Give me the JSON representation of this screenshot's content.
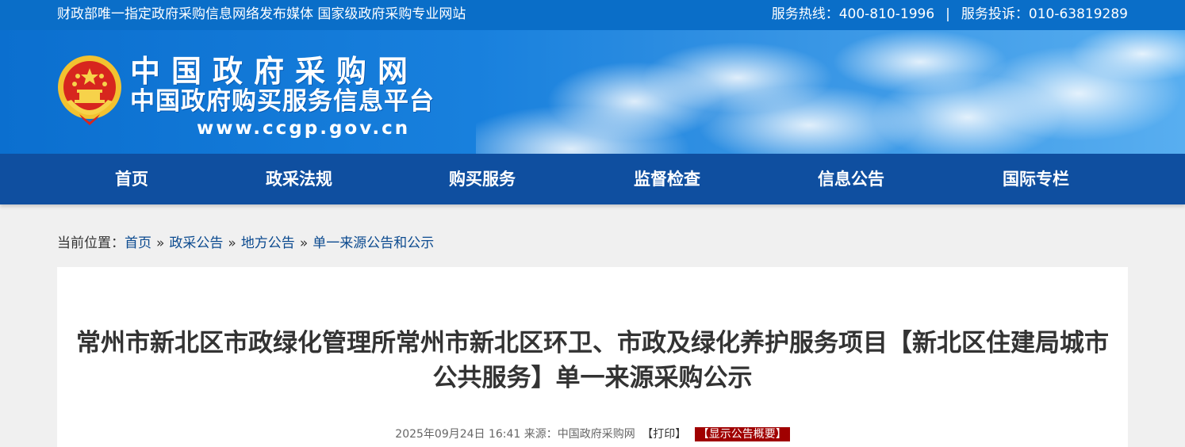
{
  "topbar": {
    "slogan": "财政部唯一指定政府采购信息网络发布媒体 国家级政府采购专业网站",
    "hotline": "服务热线：400-810-1996",
    "separator": "|",
    "complaint": "服务投诉：010-63819289"
  },
  "header": {
    "logo_title": "中国政府采购网",
    "logo_subtitle": "中国政府购买服务信息平台",
    "logo_url": "www.ccgp.gov.cn",
    "emblem_icon": "national-emblem-icon"
  },
  "nav": {
    "items": [
      {
        "label": "首页"
      },
      {
        "label": "政采法规"
      },
      {
        "label": "购买服务"
      },
      {
        "label": "监督检查"
      },
      {
        "label": "信息公告"
      },
      {
        "label": "国际专栏"
      }
    ]
  },
  "breadcrumb": {
    "prefix": "当前位置：",
    "items": [
      "首页",
      "政采公告",
      "地方公告",
      "单一来源公告和公示"
    ],
    "arrow": "»"
  },
  "article": {
    "title": "常州市新北区市政绿化管理所常州市新北区环卫、市政及绿化养护服务项目【新北区住建局城市公共服务】单一来源采购公示",
    "datetime": "2025年09月24日 16:41",
    "source": "来源：中国政府采购网",
    "print_label": "【打印】",
    "summary_label": "【显示公告概要】"
  },
  "colors": {
    "topbar_bg": "#0a6ec8",
    "nav_bg": "#0f4fa0",
    "summary_bg": "#a00000"
  }
}
